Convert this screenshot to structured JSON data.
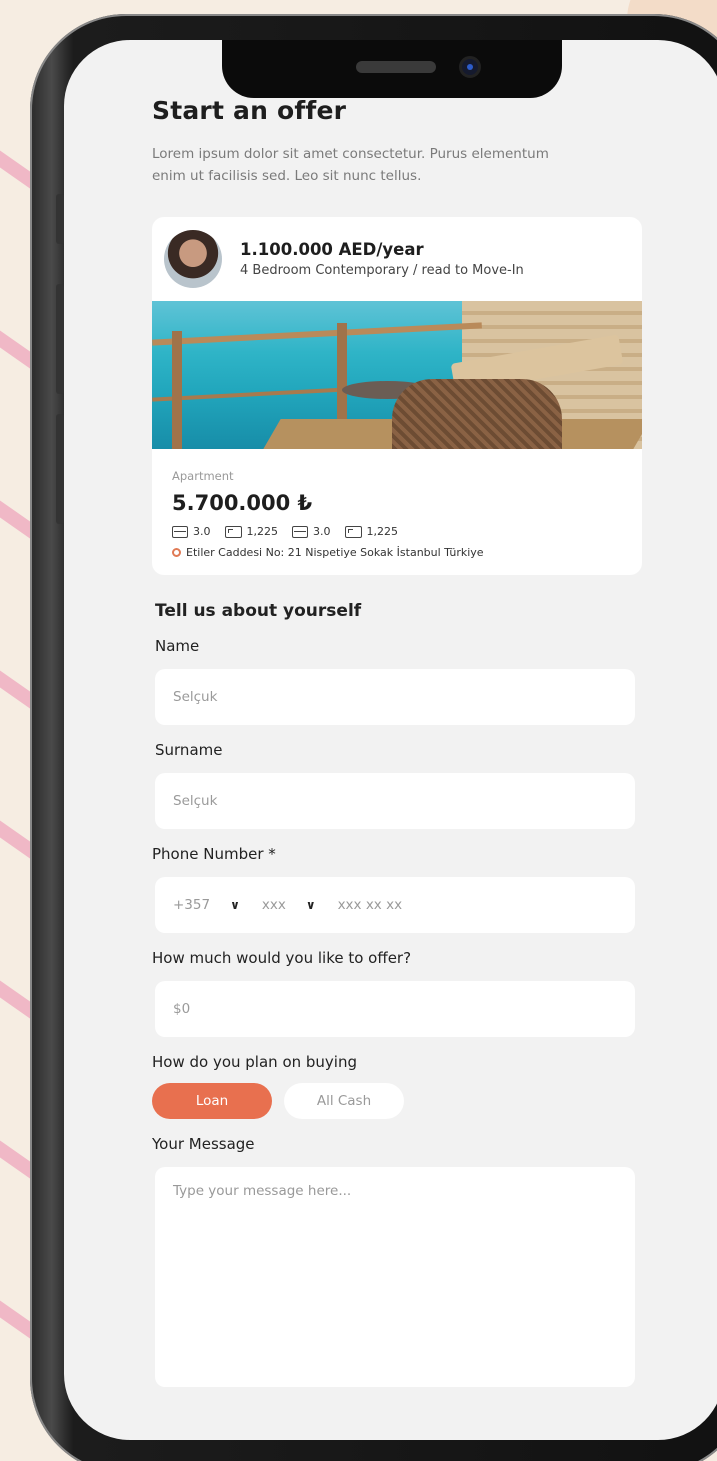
{
  "header": {
    "title": "Start an offer",
    "subtitle": "Lorem ipsum dolor sit amet consectetur. Purus elementum enim ut facilisis sed. Leo sit nunc tellus."
  },
  "listing": {
    "price_year": "1.100.000 AED/year",
    "property_name": "4 Bedroom Contemporary / read to Move-In",
    "type": "Apartment",
    "price": "5.700.000 ₺",
    "stats": [
      {
        "icon": "bed-icon",
        "value": "3.0"
      },
      {
        "icon": "area-icon",
        "value": "1,225"
      },
      {
        "icon": "bed-icon",
        "value": "3.0"
      },
      {
        "icon": "area-icon",
        "value": "1,225"
      }
    ],
    "address": "Etiler Caddesi No: 21 Nispetiye Sokak İstanbul Türkiye"
  },
  "form": {
    "section_title": "Tell us about yourself",
    "name_label": "Name",
    "name_placeholder": "Selçuk",
    "surname_label": "Surname",
    "surname_placeholder": "Selçuk",
    "phone_label": "Phone Number *",
    "phone_code": "+357",
    "phone_area": "xxx",
    "phone_number": "xxx xx xx",
    "offer_label": "How much would you like to offer?",
    "offer_placeholder": "$0",
    "buying_label": "How do you plan on buying",
    "buying_options": [
      "Loan",
      "All Cash"
    ],
    "buying_selected": "Loan",
    "message_label": "Your Message",
    "message_placeholder": "Type your message here..."
  },
  "colors": {
    "accent": "#e8704f",
    "background": "#f6ede2",
    "screen": "#f2f2f2"
  }
}
